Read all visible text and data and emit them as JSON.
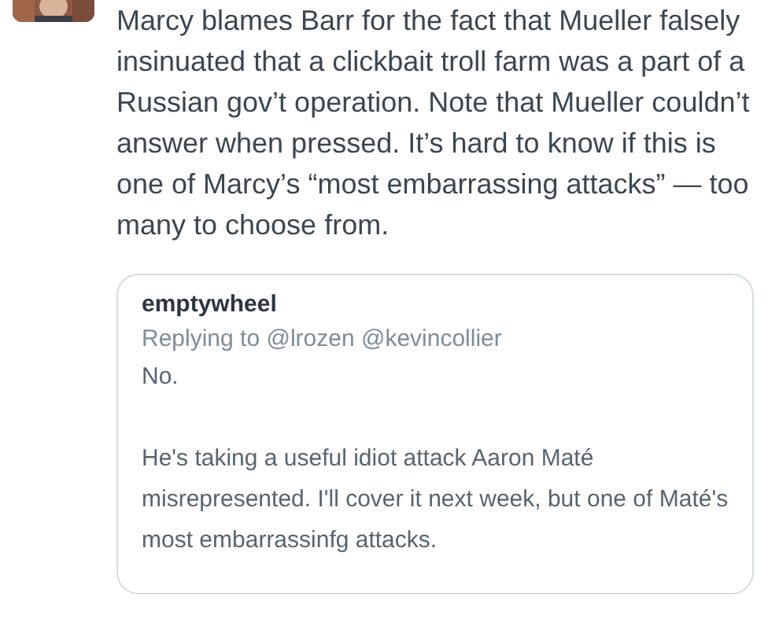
{
  "tweet": {
    "text": "Marcy blames Barr for the fact that Mueller falsely insinuated that a clickbait troll farm was a part of a Russian gov’t operation. Note that Mueller couldn’t answer when pressed. It’s hard to know if this is one of Marcy’s “most embarrassing attacks” — too many to choose from."
  },
  "quoted_tweet": {
    "author": "emptywheel",
    "replying_to": "Replying to @lrozen @kevincollier",
    "paragraphs": [
      "No.",
      "He's taking a useful idiot attack Aaron Maté misrepresented. I'll cover it next week, but one of Maté's most embarrassinfg attacks."
    ]
  }
}
